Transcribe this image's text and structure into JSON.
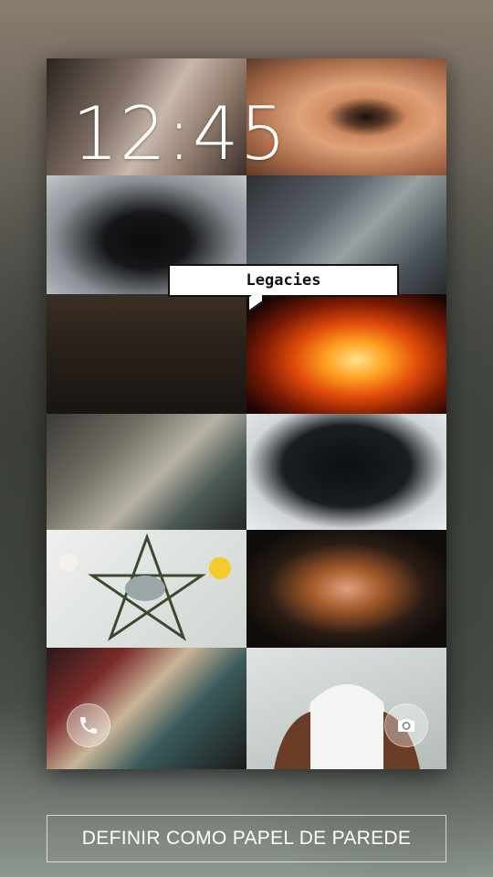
{
  "lockscreen": {
    "time": "12:45",
    "collage_caption": "Legacies",
    "icons": {
      "phone": "phone-icon",
      "camera": "camera-icon"
    }
  },
  "collage_tiles": [
    {
      "name": "tile-face"
    },
    {
      "name": "tile-eye"
    },
    {
      "name": "tile-wolf"
    },
    {
      "name": "tile-spellbook"
    },
    {
      "name": "tile-group-photo"
    },
    {
      "name": "tile-fire"
    },
    {
      "name": "tile-paint-jars"
    },
    {
      "name": "tile-curly-hair"
    },
    {
      "name": "tile-flower-pentagram"
    },
    {
      "name": "tile-fire-hand"
    },
    {
      "name": "tile-comics"
    },
    {
      "name": "tile-shirt-man"
    }
  ],
  "actions": {
    "set_wallpaper_label": "DEFINIR COMO PAPEL DE PAREDE"
  }
}
